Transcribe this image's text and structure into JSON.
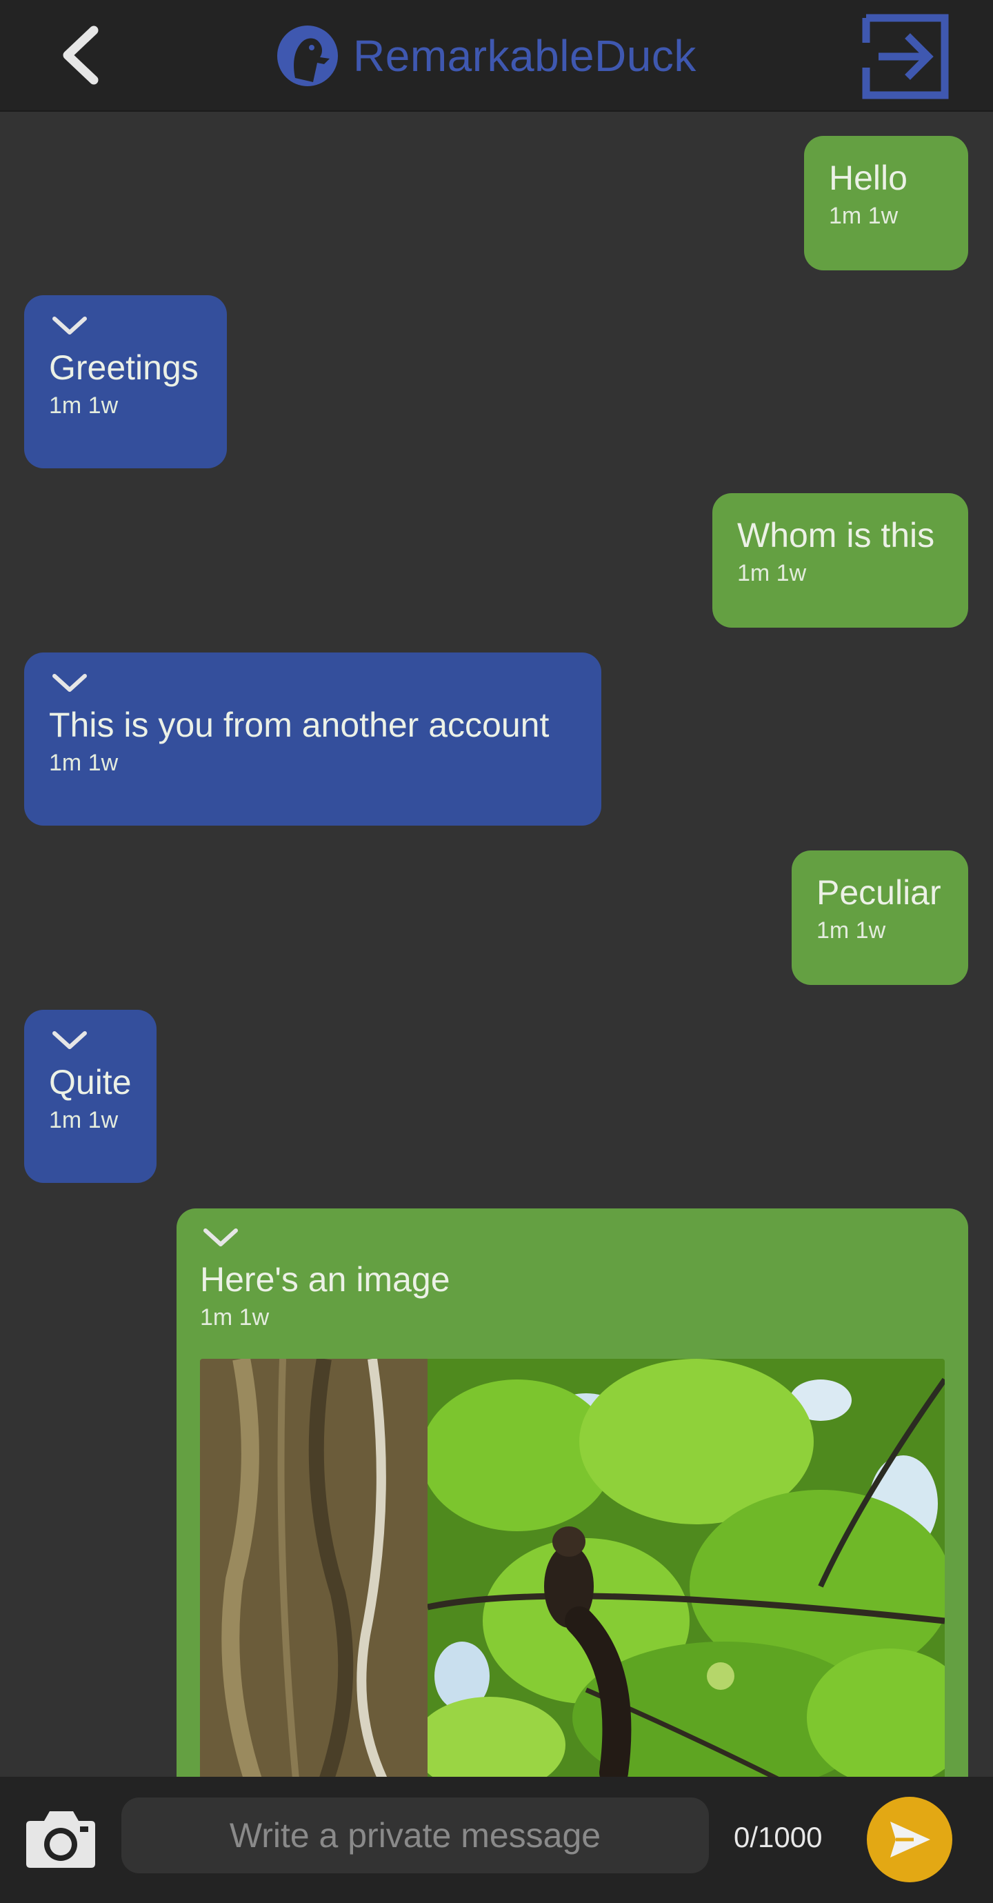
{
  "header": {
    "title": "RemarkableDuck",
    "back_icon": "chevron-left-icon",
    "exit_icon": "sign-out-icon",
    "accent_color": "#3f58b0"
  },
  "messages": [
    {
      "id": "hello",
      "direction": "sent",
      "text": "Hello",
      "time": "1m 1w"
    },
    {
      "id": "greet",
      "direction": "received",
      "text": "Greetings",
      "time": "1m 1w"
    },
    {
      "id": "whom",
      "direction": "sent",
      "text": "Whom is this",
      "time": "1m 1w"
    },
    {
      "id": "you",
      "direction": "received",
      "text": "This is you from another account",
      "time": "1m 1w"
    },
    {
      "id": "pec",
      "direction": "sent",
      "text": "Peculiar",
      "time": "1m 1w"
    },
    {
      "id": "quite",
      "direction": "received",
      "text": "Quite",
      "time": "1m 1w"
    },
    {
      "id": "image",
      "direction": "sent",
      "text": "Here's an image",
      "time": "1m 1w",
      "attachment": "image"
    }
  ],
  "colors": {
    "sent_bubble": "#64a042",
    "received_bubble": "#344f9c",
    "send_button": "#e3a814"
  },
  "composer": {
    "placeholder": "Write a private message",
    "value": "",
    "char_count": "0/1000",
    "camera_icon": "camera-icon",
    "send_icon": "send-icon"
  }
}
